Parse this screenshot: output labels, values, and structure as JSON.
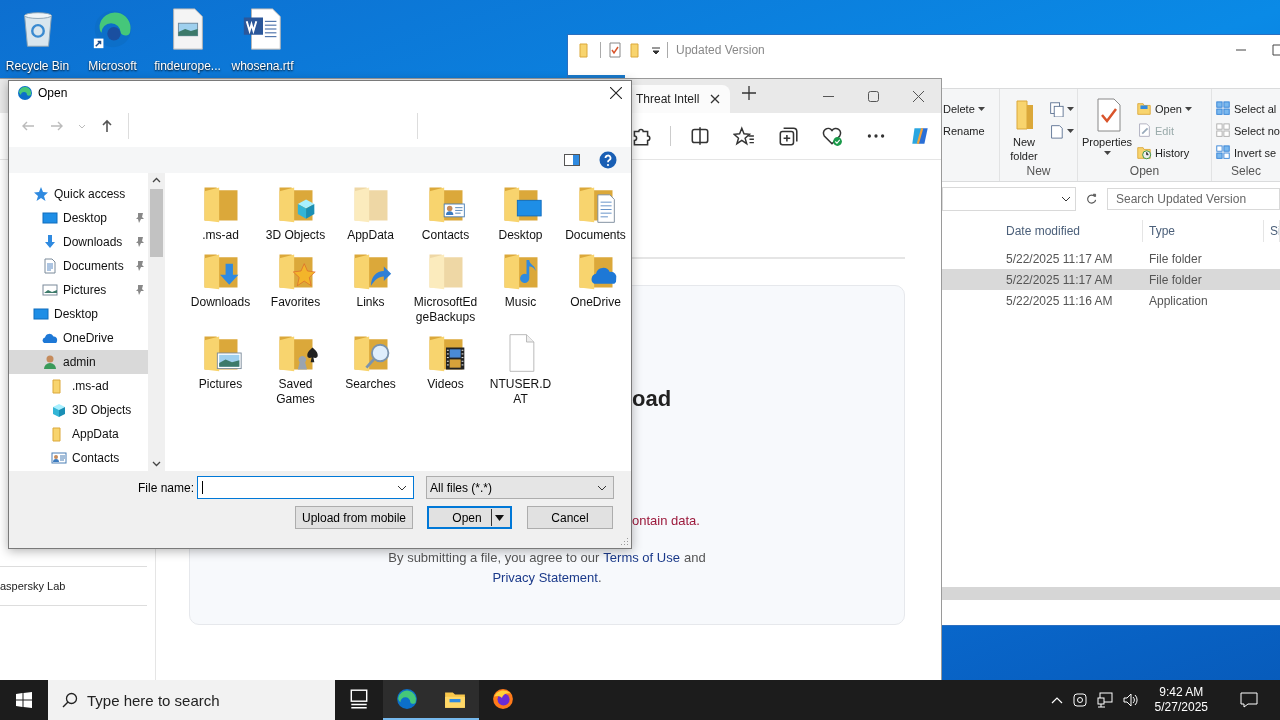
{
  "desktop": {
    "icons": [
      {
        "label": "Recycle Bin",
        "kind": "recycle"
      },
      {
        "label": "Microsoft",
        "kind": "edge"
      },
      {
        "label": "findeurope...",
        "kind": "image"
      },
      {
        "label": "whosena.rtf",
        "kind": "word"
      }
    ]
  },
  "explorer": {
    "title": "Updated Version",
    "ribbon_groups": [
      {
        "items": [
          {
            "kind": "delete",
            "label": "Delete",
            "dropdown": true,
            "disabled": false
          },
          {
            "kind": "rename",
            "label": "Rename",
            "dropdown": false,
            "disabled": false
          }
        ]
      },
      {
        "label": "New",
        "items": [
          {
            "kind": "new-folder",
            "label": "New folder",
            "dropdown": false,
            "disabled": false
          },
          {
            "kind": "new-item",
            "dropdown": true,
            "disabled": false
          },
          {
            "kind": "easy-access",
            "dropdown": true,
            "disabled": false
          }
        ]
      },
      {
        "label": "Open",
        "items": [
          {
            "kind": "properties",
            "label": "Properties",
            "dropdown": true,
            "disabled": false
          },
          {
            "kind": "open",
            "label": "Open",
            "dropdown": true,
            "disabled": false
          },
          {
            "kind": "edit",
            "label": "Edit",
            "dropdown": false,
            "disabled": true
          },
          {
            "kind": "history",
            "label": "History",
            "dropdown": false,
            "disabled": false
          }
        ]
      },
      {
        "label": "Selec",
        "items": [
          {
            "kind": "select-all",
            "label": "Select al",
            "dropdown": false,
            "disabled": false
          },
          {
            "kind": "select-none",
            "label": "Select no",
            "dropdown": false,
            "disabled": false
          },
          {
            "kind": "invert",
            "label": "Invert se",
            "dropdown": false,
            "disabled": false
          }
        ]
      }
    ],
    "search": {
      "placeholder": "Search Updated Version"
    },
    "columns": [
      "Date modified",
      "Type",
      "Si"
    ],
    "rows": [
      {
        "date": "5/22/2025 11:17 AM",
        "type": "File folder",
        "selected": false
      },
      {
        "date": "5/22/2025 11:17 AM",
        "type": "File folder",
        "selected": true
      },
      {
        "date": "5/22/2025 11:16 AM",
        "type": "Application",
        "selected": false
      }
    ]
  },
  "browser": {
    "tab": {
      "title": "Threat Intell"
    },
    "page": {
      "sidebar_text": "aspersky Lab",
      "heading": "oad",
      "error": "ontain data.",
      "terms": {
        "before": "By submitting a file, you agree to our",
        "link": "Terms of Use",
        "after": "and"
      },
      "privacy": {
        "link": "Privacy Statement",
        "after": "."
      }
    }
  },
  "dialog": {
    "title": "Open",
    "tree": [
      {
        "label": "Quick access",
        "kind": "star",
        "selected": false,
        "children": [
          {
            "label": "Desktop",
            "kind": "desktop",
            "selected": false,
            "pinned": true
          },
          {
            "label": "Downloads",
            "kind": "downloads",
            "selected": false,
            "pinned": true
          },
          {
            "label": "Documents",
            "kind": "documents",
            "selected": false,
            "pinned": true
          },
          {
            "label": "Pictures",
            "kind": "pictures",
            "selected": false,
            "pinned": true
          }
        ]
      },
      {
        "label": "Desktop",
        "kind": "desktop",
        "selected": false,
        "children": [
          {
            "label": "OneDrive",
            "kind": "onedrive",
            "selected": false
          },
          {
            "label": "admin",
            "kind": "user",
            "selected": true,
            "children": [
              {
                "label": ".ms-ad",
                "kind": "folder",
                "selected": false
              },
              {
                "label": "3D Objects",
                "kind": "cube",
                "selected": false
              },
              {
                "label": "AppData",
                "kind": "folder",
                "selected": false
              },
              {
                "label": "Contacts",
                "kind": "contacts",
                "selected": false
              }
            ]
          }
        ]
      }
    ],
    "items": [
      {
        "label": ".ms-ad",
        "kind": "folder",
        "hidden": false
      },
      {
        "label": "3D Objects",
        "kind": "cube",
        "hidden": false
      },
      {
        "label": "AppData",
        "kind": "folder",
        "hidden": true
      },
      {
        "label": "Contacts",
        "kind": "contacts",
        "hidden": false
      },
      {
        "label": "Desktop",
        "kind": "desktop",
        "hidden": false
      },
      {
        "label": "Documents",
        "kind": "documents",
        "hidden": false
      },
      {
        "label": "Downloads",
        "kind": "downloads",
        "hidden": false
      },
      {
        "label": "Favorites",
        "kind": "favorites",
        "hidden": false
      },
      {
        "label": "Links",
        "kind": "links",
        "hidden": false
      },
      {
        "label": "MicrosoftEdgeBackups",
        "kind": "folder",
        "hidden": true
      },
      {
        "label": "Music",
        "kind": "music",
        "hidden": false
      },
      {
        "label": "OneDrive",
        "kind": "onedrive",
        "hidden": false
      },
      {
        "label": "Pictures",
        "kind": "pictures",
        "hidden": false
      },
      {
        "label": "Saved Games",
        "kind": "games",
        "hidden": false
      },
      {
        "label": "Searches",
        "kind": "searches",
        "hidden": false
      },
      {
        "label": "Videos",
        "kind": "videos",
        "hidden": false
      },
      {
        "label": "NTUSER.DAT",
        "kind": "file",
        "hidden": false
      }
    ],
    "file_name": {
      "label": "File name:"
    },
    "file_type": "All files (*.*)",
    "buttons": [
      {
        "label": "Upload from mobile",
        "kind": "normal",
        "default": false
      },
      {
        "label": "Open",
        "kind": "split",
        "default": true
      },
      {
        "label": "Cancel",
        "kind": "normal",
        "default": false
      }
    ]
  },
  "taskbar": {
    "search": {
      "placeholder": "Type here to search"
    },
    "apps": [
      {
        "kind": "taskview",
        "active": false
      },
      {
        "kind": "edge",
        "active": true
      },
      {
        "kind": "explorer",
        "active": true
      },
      {
        "kind": "firefox",
        "active": false
      }
    ],
    "time": "9:42 AM",
    "date": "5/27/2025"
  }
}
